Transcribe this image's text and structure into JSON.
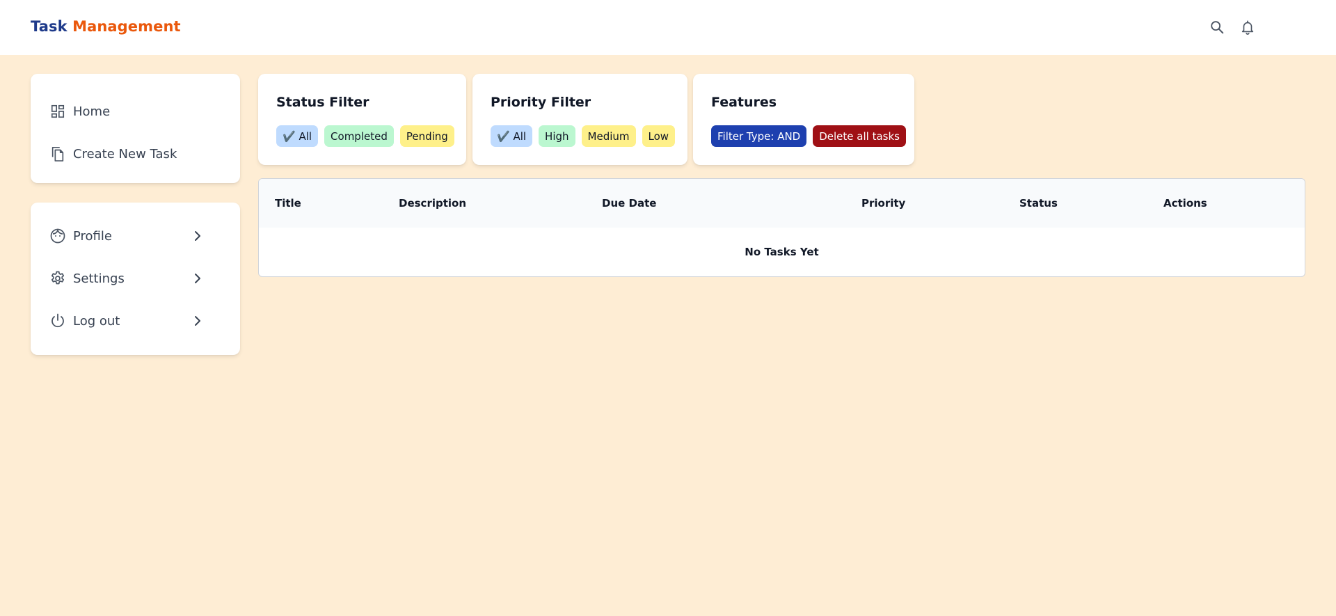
{
  "brand": {
    "part1": "Task",
    "part2": "Management"
  },
  "topbar": {
    "icons": [
      "search-icon",
      "bell-icon"
    ]
  },
  "sidebar": {
    "main": [
      {
        "label": "Home",
        "icon": "dashboard-icon"
      },
      {
        "label": "Create New Task",
        "icon": "copy-icon"
      }
    ],
    "account": [
      {
        "label": "Profile",
        "icon": "face-icon"
      },
      {
        "label": "Settings",
        "icon": "gear-icon"
      },
      {
        "label": "Log out",
        "icon": "power-icon"
      }
    ]
  },
  "status_filter": {
    "title": "Status Filter",
    "chips": [
      "✔️ All",
      "Completed",
      "Pending"
    ]
  },
  "priority_filter": {
    "title": "Priority Filter",
    "chips": [
      "✔️ All",
      "High",
      "Medium",
      "Low"
    ]
  },
  "features": {
    "title": "Features",
    "filter_type": "Filter Type: AND",
    "delete_all": "Delete all tasks"
  },
  "table": {
    "columns": [
      "Title",
      "Description",
      "Due Date",
      "Priority",
      "Status",
      "Actions"
    ],
    "empty_text": "No Tasks Yet"
  },
  "colors": {
    "background": "#feedd4",
    "brand_primary": "#1e3a8a",
    "brand_accent": "#ea580c",
    "chip_all": "#bfdbfe",
    "chip_completed": "#bbf7d0",
    "chip_pending": "#fef08a",
    "filter_type_btn": "#1e40af",
    "delete_btn": "#9f1015"
  }
}
